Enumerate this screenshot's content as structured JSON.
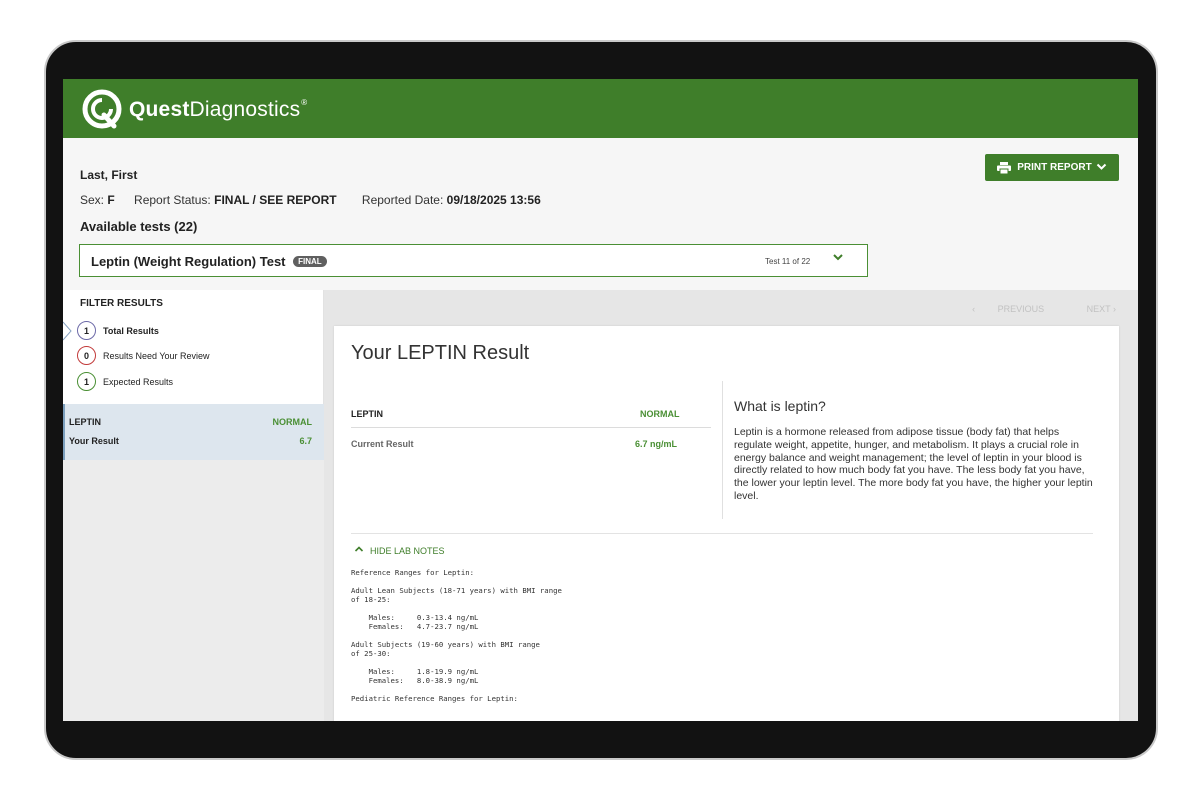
{
  "brand": {
    "name_bold": "Quest",
    "name_regular": "Diagnostics",
    "reg_mark": "®",
    "color": "#3f7e2a"
  },
  "patient": {
    "name": "Last, First",
    "sex_label": "Sex:",
    "sex_value": "F",
    "status_label": "Report Status:",
    "status_value": "FINAL / SEE REPORT",
    "date_label": "Reported Date:",
    "date_value": "09/18/2025 13:56"
  },
  "tests": {
    "available_label": "Available tests (22)",
    "current_test": "Leptin (Weight Regulation) Test",
    "current_badge": "FINAL",
    "counter": "Test 11 of 22"
  },
  "actions": {
    "print_label": "PRINT REPORT"
  },
  "filter": {
    "title": "FILTER RESULTS",
    "items": [
      {
        "count": "1",
        "label": "Total Results",
        "color": "#6d6aa8"
      },
      {
        "count": "0",
        "label": "Results Need Your Review",
        "color": "#c23b3b"
      },
      {
        "count": "1",
        "label": "Expected Results",
        "color": "#4a8f34"
      }
    ]
  },
  "selected_result": {
    "analyte": "LEPTIN",
    "status": "NORMAL",
    "label": "Your Result",
    "value": "6.7"
  },
  "pager": {
    "previous": "PREVIOUS",
    "next": "NEXT"
  },
  "result_card": {
    "title": "Your LEPTIN Result",
    "analyte": "LEPTIN",
    "status": "NORMAL",
    "current_label": "Current Result",
    "current_value": "6.7 ng/mL",
    "info_title": "What is leptin?",
    "info_text": "Leptin is a hormone released from adipose tissue (body fat) that helps regulate weight, appetite, hunger, and metabolism. It plays a crucial role in energy balance and weight management; the level of leptin in your blood is directly related to how much body fat you have. The less body fat you have, the lower your leptin level. The more body fat you have, the higher your leptin level.",
    "toggle_label": "HIDE LAB NOTES",
    "lab_notes": "Reference Ranges for Leptin:\n\nAdult Lean Subjects (18-71 years) with BMI range\nof 18-25:\n\n    Males:     0.3-13.4 ng/mL\n    Females:   4.7-23.7 ng/mL\n\nAdult Subjects (19-60 years) with BMI range\nof 25-30:\n\n    Males:     1.8-19.9 ng/mL\n    Females:   8.0-38.9 ng/mL\n\nPediatric Reference Ranges for Leptin:"
  }
}
